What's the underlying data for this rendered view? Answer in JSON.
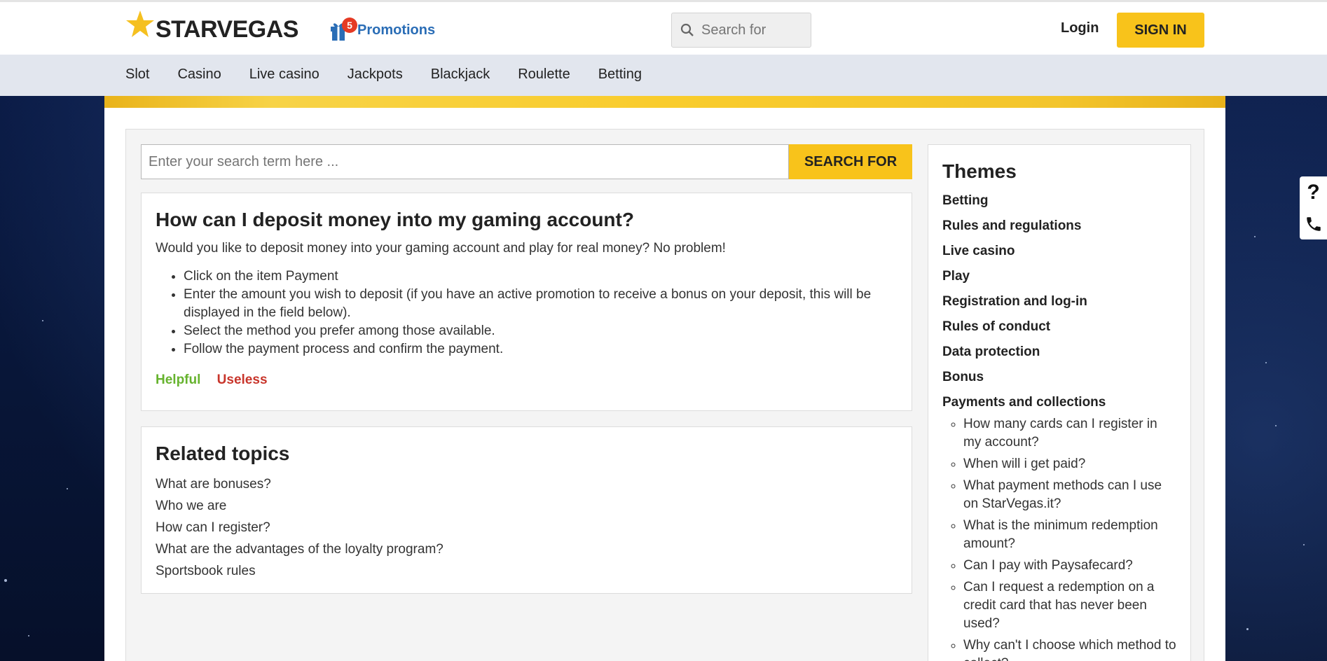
{
  "header": {
    "logo_text": "STARVEGAS",
    "promotions_label": "Promotions",
    "promotions_count": "5",
    "search_placeholder": "Search for",
    "login_label": "Login",
    "signin_label": "SIGN IN"
  },
  "nav": {
    "items": [
      "Slot",
      "Casino",
      "Live casino",
      "Jackpots",
      "Blackjack",
      "Roulette",
      "Betting"
    ]
  },
  "faq_search": {
    "placeholder": "Enter your search term here ...",
    "button_label": "SEARCH FOR"
  },
  "article": {
    "title": "How can I deposit money into my gaming account?",
    "lead": "Would you like to deposit money into your gaming account and play for real money? No problem!",
    "steps": [
      "Click on the item Payment",
      "Enter the amount you wish to deposit (if you have an active promotion to receive a bonus on your deposit, this will be displayed in the field below).",
      "Select the method you prefer among those available.",
      "Follow the payment process and confirm the payment."
    ],
    "helpful_label": "Helpful",
    "useless_label": "Useless"
  },
  "related": {
    "title": "Related topics",
    "items": [
      "What are bonuses?",
      "Who we are",
      "How can I register?",
      "What are the advantages of the loyalty program?",
      "Sportsbook rules"
    ]
  },
  "sidebar": {
    "title": "Themes",
    "themes": [
      "Betting",
      "Rules and regulations",
      "Live casino",
      "Play",
      "Registration and log-in",
      "Rules of conduct",
      "Data protection",
      "Bonus",
      "Payments and collections"
    ],
    "payment_questions": [
      "How many cards can I register in my account?",
      "When will i get paid?",
      "What payment methods can I use on StarVegas.it?",
      "What is the minimum redemption amount?",
      "Can I pay with Paysafecard?",
      "Can I request a redemption on a credit card that has never been used?",
      "Why can't I choose which method to collect?"
    ]
  },
  "colors": {
    "brand_yellow": "#f8c31b",
    "link_blue": "#2a6db6",
    "helpful_green": "#66b32e",
    "useless_red": "#c8352b",
    "badge_red": "#e53a24"
  },
  "side_tools": {
    "icons": [
      "question-icon",
      "phone-icon"
    ]
  }
}
